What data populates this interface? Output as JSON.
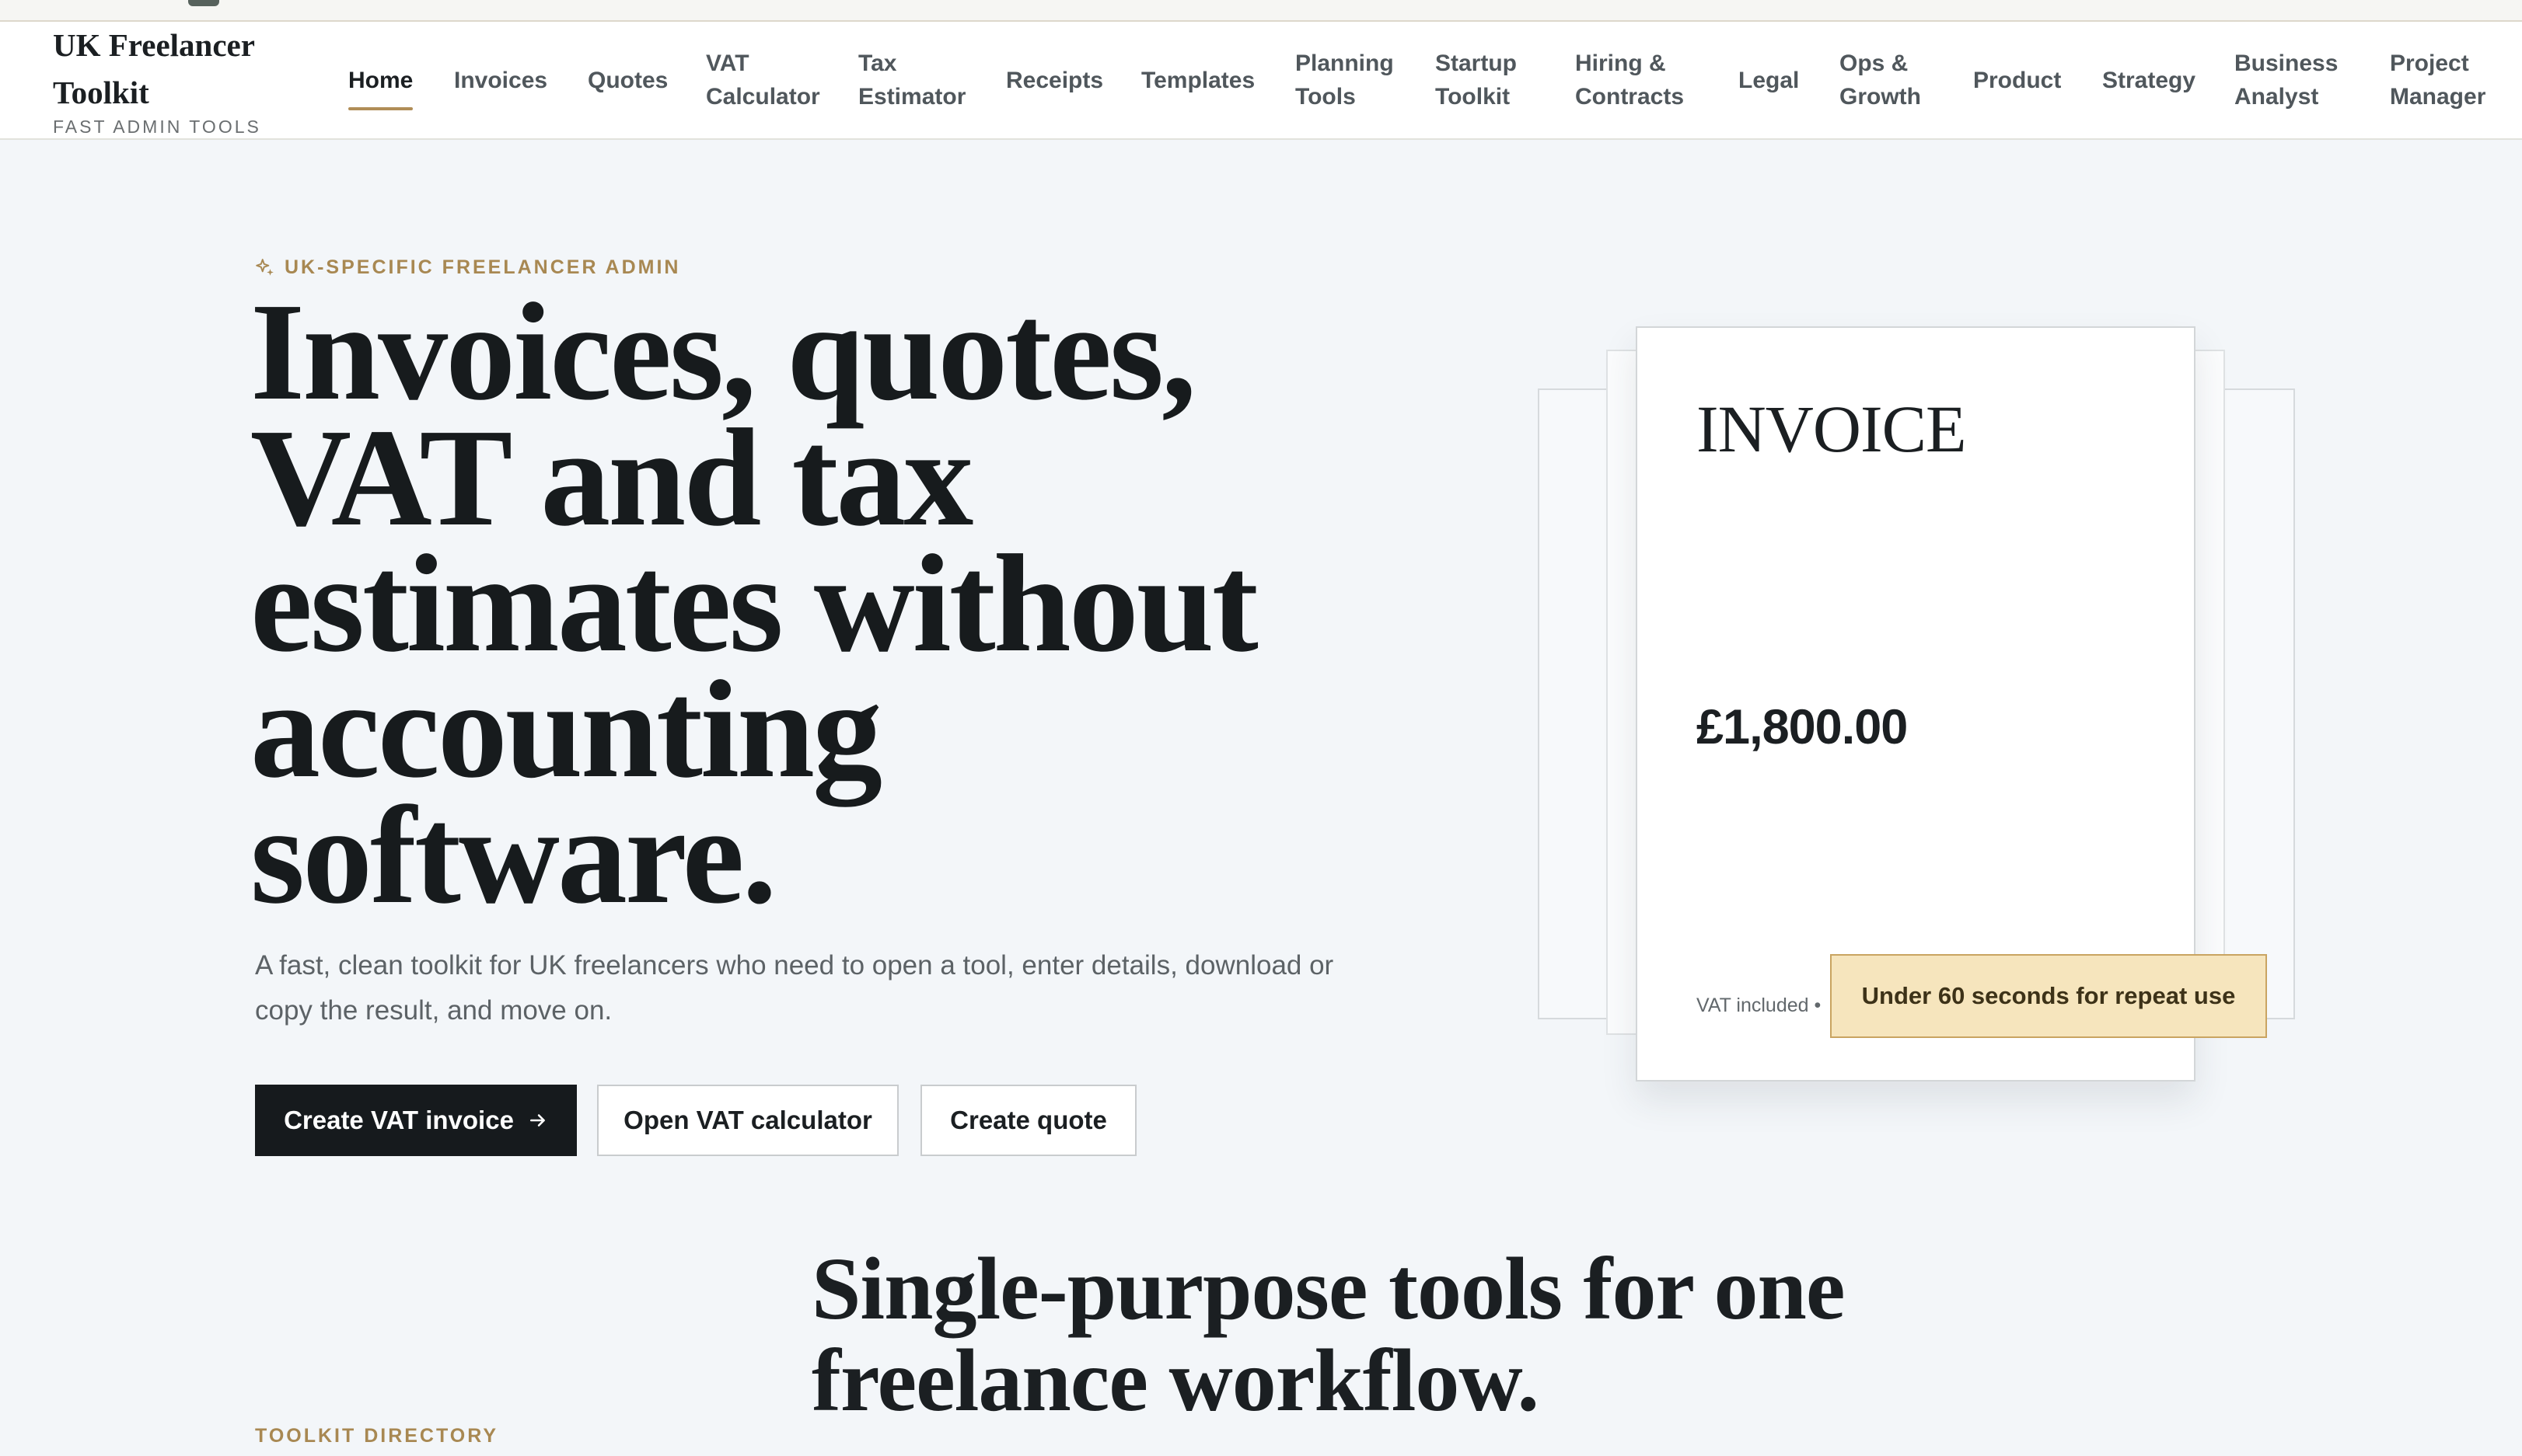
{
  "header": {
    "brand_title": "UK Freelancer Toolkit",
    "brand_subtitle": "FAST ADMIN TOOLS",
    "nav": [
      {
        "label": "Home",
        "active": true
      },
      {
        "label": "Invoices"
      },
      {
        "label": "Quotes"
      },
      {
        "label": "VAT Calculator"
      },
      {
        "label": "Tax Estimator"
      },
      {
        "label": "Receipts"
      },
      {
        "label": "Templates"
      },
      {
        "label": "Planning Tools"
      },
      {
        "label": "Startup Toolkit"
      },
      {
        "label": "Hiring & Contracts"
      },
      {
        "label": "Legal"
      },
      {
        "label": "Ops & Growth"
      },
      {
        "label": "Product"
      },
      {
        "label": "Strategy"
      },
      {
        "label": "Business Analyst"
      },
      {
        "label": "Project Manager"
      }
    ]
  },
  "hero": {
    "eyebrow_icon": "sparkle-icon",
    "eyebrow": "UK-SPECIFIC FREELANCER ADMIN",
    "title": "Invoices, quotes, VAT and tax estimates without accounting software.",
    "description": "A fast, clean toolkit for UK freelancers who need to open a tool, enter details, download or copy the result, and move on.",
    "buttons": {
      "primary": "Create VAT invoice",
      "primary_icon": "arrow-right-icon",
      "vat_calculator": "Open VAT calculator",
      "quote": "Create quote"
    }
  },
  "invoice_preview": {
    "heading": "INVOICE",
    "amount": "£1,800.00",
    "vat_note": "VAT included •",
    "badge": "Under 60 seconds for repeat use"
  },
  "directory": {
    "label": "TOOLKIT DIRECTORY",
    "title": "Single-purpose tools for one freelance workflow."
  },
  "colors": {
    "accent": "#b08d57",
    "primary_button": "#161a1d",
    "badge_bg": "#f6e5bd",
    "page_bg": "#f3f6f9"
  }
}
